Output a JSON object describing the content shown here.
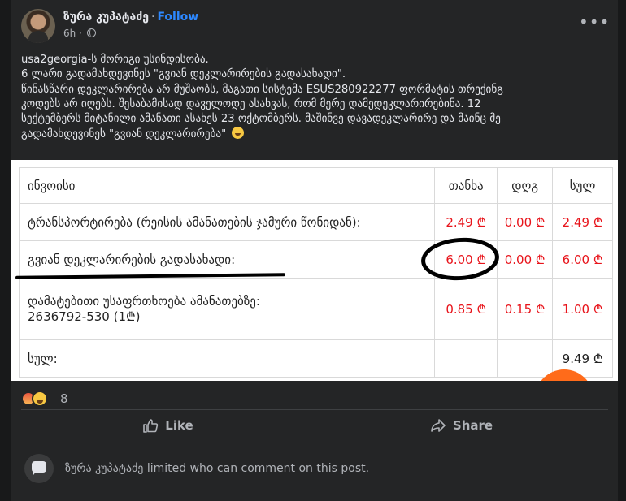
{
  "post": {
    "author": "ზურა კუპატაძე",
    "separator": "·",
    "follow_label": "Follow",
    "time": "6h ·",
    "more_label": "•••",
    "text_lines": [
      "usa2georgia-ს მორიგი უსინდისობა.",
      "6 ლარი გადამახდევინეს \"გვიან დეკლარირების გადასახადი\".",
      "წინასწარი დეკლარირება არ მუშაობს, მაგათი სისტემა ESUS280922277 ფორმატის თრექინგ",
      "კოდებს არ იღებს. შესაბამისად დაველოდე ასახვას, რომ მერე დამედეკლარირებინა. 12",
      "სექტემბერს მიტანილი ამანათი ასახეს 23 ოქტომბერს. მაშინვე დავადეკლარირე და მაინც მე",
      "გადამახდევინეს \"გვიან დეკლარირება\""
    ]
  },
  "invoice": {
    "header": {
      "item": "ინვოისი",
      "price": "თანხა",
      "vat": "დღგ",
      "total": "სულ"
    },
    "rows": [
      {
        "label": "ტრანსპორტირება (რეისის ამანათების ჯამური წონიდან):",
        "price": "2.49 ₾",
        "vat": "0.00 ₾",
        "total": "2.49 ₾"
      },
      {
        "label": "გვიან დეკლარირების გადასახადი:",
        "price": "6.00 ₾",
        "vat": "0.00 ₾",
        "total": "6.00 ₾"
      },
      {
        "label": "დამატებითი უსაფრთხოება ამანათებზე:",
        "label2": "2636792-530 (1₾)",
        "price": "0.85 ₾",
        "vat": "0.15 ₾",
        "total": "1.00 ₾"
      }
    ],
    "sum_row": {
      "label": "სულ:",
      "total": "9.49 ₾"
    }
  },
  "reactions": {
    "count": "8",
    "types": [
      "angry-icon",
      "haha-icon"
    ]
  },
  "actions": {
    "like_label": "Like",
    "share_label": "Share"
  },
  "comment_restriction": "ზურა კუპატაძე limited who can comment on this post.",
  "colors": {
    "accent": "#2d88ff",
    "price_red": "#e8141b",
    "card_bg": "#242526",
    "page_bg": "#18191a"
  }
}
